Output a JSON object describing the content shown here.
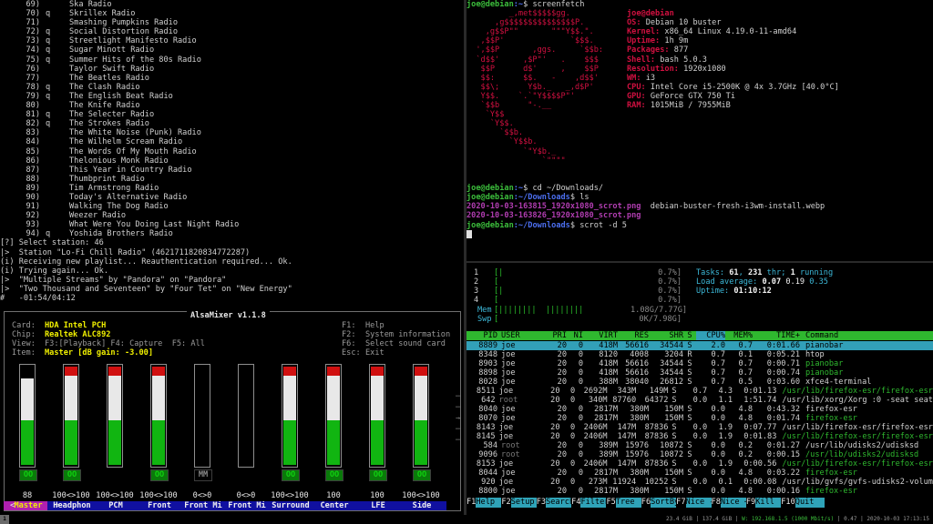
{
  "pianobar": {
    "stations": [
      {
        "num": "69)",
        "q": "",
        "name": "Ska Radio"
      },
      {
        "num": "70)",
        "q": "q",
        "name": "Skrillex Radio"
      },
      {
        "num": "71)",
        "q": "",
        "name": "Smashing Pumpkins Radio"
      },
      {
        "num": "72)",
        "q": "q",
        "name": "Social Distortion Radio"
      },
      {
        "num": "73)",
        "q": "q",
        "name": "Streetlight Manifesto Radio"
      },
      {
        "num": "74)",
        "q": "q",
        "name": "Sugar Minott Radio"
      },
      {
        "num": "75)",
        "q": "q",
        "name": "Summer Hits of the 80s Radio"
      },
      {
        "num": "76)",
        "q": "",
        "name": "Taylor Swift Radio"
      },
      {
        "num": "77)",
        "q": "",
        "name": "The Beatles Radio"
      },
      {
        "num": "78)",
        "q": "q",
        "name": "The Clash Radio"
      },
      {
        "num": "79)",
        "q": "q",
        "name": "The English Beat Radio"
      },
      {
        "num": "80)",
        "q": "",
        "name": "The Knife Radio"
      },
      {
        "num": "81)",
        "q": "q",
        "name": "The Selecter Radio"
      },
      {
        "num": "82)",
        "q": "q",
        "name": "The Strokes Radio"
      },
      {
        "num": "83)",
        "q": "",
        "name": "The White Noise (Punk) Radio"
      },
      {
        "num": "84)",
        "q": "",
        "name": "The Wilhelm Scream Radio"
      },
      {
        "num": "85)",
        "q": "",
        "name": "The Words Of My Mouth Radio"
      },
      {
        "num": "86)",
        "q": "",
        "name": "Thelonious Monk Radio"
      },
      {
        "num": "87)",
        "q": "",
        "name": "This Year in Country Radio"
      },
      {
        "num": "88)",
        "q": "",
        "name": "Thumbprint Radio"
      },
      {
        "num": "89)",
        "q": "",
        "name": "Tim Armstrong Radio"
      },
      {
        "num": "90)",
        "q": "",
        "name": "Today's Alternative Radio"
      },
      {
        "num": "91)",
        "q": "",
        "name": "Walking The Dog Radio"
      },
      {
        "num": "92)",
        "q": "",
        "name": "Weezer Radio"
      },
      {
        "num": "93)",
        "q": "",
        "name": "What Were You Doing Last Night Radio"
      },
      {
        "num": "94)",
        "q": "q",
        "name": "Yoshida Brothers Radio"
      }
    ],
    "log": [
      "[?] Select station: 46",
      "|>  Station \"Lo-Fi Chill Radio\" (4621711820834772287)",
      "(i) Receiving new playlist... Reauthentication required... Ok.",
      "(i) Trying again... Ok.",
      "|>  \"Multiple Streams\" by \"Pandora\" on \"Pandora\"",
      "|>  \"Two Thousand and Seventeen\" by \"Four Tet\" on \"New Energy\"",
      "#   -01:54/04:12"
    ]
  },
  "alsamixer": {
    "title": "AlsaMixer v1.1.8",
    "card_label": "Card:",
    "card": "HDA Intel PCH",
    "chip_label": "Chip:",
    "chip": "Realtek ALC892",
    "view_label": "View:",
    "view": "F3:[Playback] F4: Capture  F5: All",
    "item_label": "Item:",
    "item": "Master [dB gain: -3.00]",
    "help": [
      {
        "key": "F1:",
        "text": "Help"
      },
      {
        "key": "F2:",
        "text": "System information"
      },
      {
        "key": "F6:",
        "text": "Select sound card"
      },
      {
        "key": "Esc:",
        "text": "Exit"
      }
    ],
    "channels": [
      {
        "name": "Master",
        "value": "88",
        "level": 0.88,
        "mute": "OO",
        "muted": false,
        "selected": true
      },
      {
        "name": "Headphon",
        "value": "100<>100",
        "level": 1.0,
        "mute": "OO",
        "muted": false
      },
      {
        "name": "PCM",
        "value": "100<>100",
        "level": 1.0,
        "mute": "",
        "muted": false
      },
      {
        "name": "Front",
        "value": "100<>100",
        "level": 1.0,
        "mute": "OO",
        "muted": false
      },
      {
        "name": "Front Mi",
        "value": "0<>0",
        "level": 0.0,
        "mute": "MM",
        "muted": true
      },
      {
        "name": "Front Mi",
        "value": "0<>0",
        "level": 0.0,
        "mute": "",
        "muted": false
      },
      {
        "name": "Surround",
        "value": "100<>100",
        "level": 1.0,
        "mute": "OO",
        "muted": false
      },
      {
        "name": "Center",
        "value": "100",
        "level": 1.0,
        "mute": "OO",
        "muted": false
      },
      {
        "name": "LFE",
        "value": "100",
        "level": 1.0,
        "mute": "OO",
        "muted": false
      },
      {
        "name": "Side",
        "value": "100<>100",
        "level": 1.0,
        "mute": "OO",
        "muted": false
      }
    ]
  },
  "screenfetch": {
    "user": "joe@debian",
    "prompt1_cmd": "$ screenfetch",
    "logo": [
      "         _,met$$$$$gg.",
      "      ,g$$$$$$$$$$$$$$$P.",
      "    ,g$$P\"\"       \"\"\"Y$$.\".",
      "   ,$$P'              `$$$.",
      "  ',$$P       ,ggs.     `$$b:",
      "  `d$$'     ,$P\"'   .    $$$",
      "   $$P      d$'     ,    $$P",
      "   $$:      $$.   -    ,d$$'",
      "   $$\\;      Y$b._   _,d$P'",
      "   Y$$.    `.`\"Y$$$$P\"'",
      "   `$$b      \"-.__",
      "    `Y$$",
      "     `Y$$.",
      "       `$$b.",
      "         `Y$$b.",
      "            `\"Y$b._",
      "                `\"\"\"\""
    ],
    "info": [
      {
        "key": "",
        "val": "joe@debian",
        "hl": true
      },
      {
        "key": "OS:",
        "val": "Debian 10 buster"
      },
      {
        "key": "Kernel:",
        "val": "x86_64 Linux 4.19.0-11-amd64"
      },
      {
        "key": "Uptime:",
        "val": "1h 9m"
      },
      {
        "key": "Packages:",
        "val": "877"
      },
      {
        "key": "Shell:",
        "val": "bash 5.0.3"
      },
      {
        "key": "Resolution:",
        "val": "1920x1080"
      },
      {
        "key": "WM:",
        "val": "i3"
      },
      {
        "key": "CPU:",
        "val": "Intel Core i5-2500K @ 4x 3.7GHz [40.0°C]"
      },
      {
        "key": "GPU:",
        "val": "GeForce GTX 750 Ti"
      },
      {
        "key": "RAM:",
        "val": "1015MiB / 7955MiB"
      }
    ],
    "prompt2_user": "joe@debian",
    "prompt2_path": ":~",
    "prompt2_cmd": "$ cd ~/Downloads/",
    "prompt3_path": ":~/Downloads",
    "prompt3_cmd": "$ ls",
    "file1": "2020-10-03-163815_1920x1080_scrot.png",
    "file2": "debian-buster-fresh-i3wm-install.webp",
    "file3": "2020-10-03-163826_1920x1080_scrot.png",
    "prompt4_cmd": "$ scrot -d 5"
  },
  "htop": {
    "cpus": [
      {
        "n": "1",
        "bar": "[|",
        "pct": "0.7%]"
      },
      {
        "n": "2",
        "bar": "[",
        "pct": "0.7%]"
      },
      {
        "n": "3",
        "bar": "[|",
        "pct": "0.7%]"
      },
      {
        "n": "4",
        "bar": "[",
        "pct": "0.7%]"
      }
    ],
    "mem": {
      "label": "Mem",
      "bar": "[||||||||  ||||||||",
      "val": "1.08G/7.77G]"
    },
    "swp": {
      "label": "Swp",
      "bar": "[",
      "val": "0K/7.98G]"
    },
    "tasks_label": "Tasks:",
    "tasks": "61",
    "thr": "231",
    "thr_label": "thr;",
    "running": "1",
    "running_label": "running",
    "load_label": "Load average:",
    "load1": "0.07",
    "load5": "0.19",
    "load15": "0.35",
    "uptime_label": "Uptime:",
    "uptime": "01:10:12",
    "headers": [
      "PID",
      "USER",
      "PRI",
      "NI",
      "VIRT",
      "RES",
      "SHR",
      "S",
      "CPU%",
      "MEM%",
      "TIME+",
      "Command"
    ],
    "rows": [
      {
        "pid": "8889",
        "user": "joe",
        "pri": "20",
        "ni": "0",
        "virt": "418M",
        "res": "56616",
        "shr": "34544",
        "s": "S",
        "cpu": "2.0",
        "mem": "0.7",
        "time": "0:01.66",
        "cmd": "pianobar",
        "sel": true
      },
      {
        "pid": "8348",
        "user": "joe",
        "pri": "20",
        "ni": "0",
        "virt": "8120",
        "res": "4008",
        "shr": "3204",
        "s": "R",
        "cpu": "0.7",
        "mem": "0.1",
        "time": "0:05.21",
        "cmd": "htop"
      },
      {
        "pid": "8903",
        "user": "joe",
        "pri": "20",
        "ni": "0",
        "virt": "418M",
        "res": "56616",
        "shr": "34544",
        "s": "S",
        "cpu": "0.7",
        "mem": "0.7",
        "time": "0:00.71",
        "cmd": "pianobar",
        "thread": true
      },
      {
        "pid": "8898",
        "user": "joe",
        "pri": "20",
        "ni": "0",
        "virt": "418M",
        "res": "56616",
        "shr": "34544",
        "s": "S",
        "cpu": "0.7",
        "mem": "0.7",
        "time": "0:00.74",
        "cmd": "pianobar",
        "thread": true
      },
      {
        "pid": "8028",
        "user": "joe",
        "pri": "20",
        "ni": "0",
        "virt": "388M",
        "res": "38040",
        "shr": "26812",
        "s": "S",
        "cpu": "0.7",
        "mem": "0.5",
        "time": "0:03.60",
        "cmd": "xfce4-terminal"
      },
      {
        "pid": "8511",
        "user": "joe",
        "pri": "20",
        "ni": "0",
        "virt": "2692M",
        "res": "343M",
        "shr": "149M",
        "s": "S",
        "cpu": "0.7",
        "mem": "4.3",
        "time": "0:01.13",
        "cmd": "/usr/lib/firefox-esr/firefox-esr",
        "thread": true
      },
      {
        "pid": "642",
        "user": "root",
        "pri": "20",
        "ni": "0",
        "virt": "340M",
        "res": "87760",
        "shr": "64372",
        "s": "S",
        "cpu": "0.0",
        "mem": "1.1",
        "time": "1:51.74",
        "cmd": "/usr/lib/xorg/Xorg :0 -seat seat"
      },
      {
        "pid": "8040",
        "user": "joe",
        "pri": "20",
        "ni": "0",
        "virt": "2817M",
        "res": "380M",
        "shr": "150M",
        "s": "S",
        "cpu": "0.0",
        "mem": "4.8",
        "time": "0:43.32",
        "cmd": "firefox-esr"
      },
      {
        "pid": "8070",
        "user": "joe",
        "pri": "20",
        "ni": "0",
        "virt": "2817M",
        "res": "380M",
        "shr": "150M",
        "s": "S",
        "cpu": "0.0",
        "mem": "4.8",
        "time": "0:01.74",
        "cmd": "firefox-esr",
        "thread": true
      },
      {
        "pid": "8143",
        "user": "joe",
        "pri": "20",
        "ni": "0",
        "virt": "2406M",
        "res": "147M",
        "shr": "87836",
        "s": "S",
        "cpu": "0.0",
        "mem": "1.9",
        "time": "0:07.77",
        "cmd": "/usr/lib/firefox-esr/firefox-esr"
      },
      {
        "pid": "8145",
        "user": "joe",
        "pri": "20",
        "ni": "0",
        "virt": "2406M",
        "res": "147M",
        "shr": "87836",
        "s": "S",
        "cpu": "0.0",
        "mem": "1.9",
        "time": "0:01.83",
        "cmd": "/usr/lib/firefox-esr/firefox-esr",
        "thread": true
      },
      {
        "pid": "584",
        "user": "root",
        "pri": "20",
        "ni": "0",
        "virt": "389M",
        "res": "15976",
        "shr": "10872",
        "s": "S",
        "cpu": "0.0",
        "mem": "0.2",
        "time": "0:01.27",
        "cmd": "/usr/lib/udisks2/udisksd"
      },
      {
        "pid": "9096",
        "user": "root",
        "pri": "20",
        "ni": "0",
        "virt": "389M",
        "res": "15976",
        "shr": "10872",
        "s": "S",
        "cpu": "0.0",
        "mem": "0.2",
        "time": "0:00.15",
        "cmd": "/usr/lib/udisks2/udisksd",
        "thread": true
      },
      {
        "pid": "8153",
        "user": "joe",
        "pri": "20",
        "ni": "0",
        "virt": "2406M",
        "res": "147M",
        "shr": "87836",
        "s": "S",
        "cpu": "0.0",
        "mem": "1.9",
        "time": "0:00.56",
        "cmd": "/usr/lib/firefox-esr/firefox-esr",
        "thread": true
      },
      {
        "pid": "8044",
        "user": "joe",
        "pri": "20",
        "ni": "0",
        "virt": "2817M",
        "res": "380M",
        "shr": "150M",
        "s": "S",
        "cpu": "0.0",
        "mem": "4.8",
        "time": "0:03.22",
        "cmd": "firefox-esr",
        "thread": true
      },
      {
        "pid": "920",
        "user": "joe",
        "pri": "20",
        "ni": "0",
        "virt": "273M",
        "res": "11924",
        "shr": "10252",
        "s": "S",
        "cpu": "0.0",
        "mem": "0.1",
        "time": "0:00.08",
        "cmd": "/usr/lib/gvfs/gvfs-udisks2-volum"
      },
      {
        "pid": "8800",
        "user": "joe",
        "pri": "20",
        "ni": "0",
        "virt": "2817M",
        "res": "380M",
        "shr": "150M",
        "s": "S",
        "cpu": "0.0",
        "mem": "4.8",
        "time": "0:00.16",
        "cmd": "firefox-esr",
        "thread": true
      }
    ],
    "fkeys": [
      {
        "k": "F1",
        "l": "Help"
      },
      {
        "k": "F2",
        "l": "Setup"
      },
      {
        "k": "F3",
        "l": "Search"
      },
      {
        "k": "F4",
        "l": "Filter"
      },
      {
        "k": "F5",
        "l": "Tree"
      },
      {
        "k": "F6",
        "l": "SortBy"
      },
      {
        "k": "F7",
        "l": "Nice -"
      },
      {
        "k": "F8",
        "l": "Nice +"
      },
      {
        "k": "F9",
        "l": "Kill"
      },
      {
        "k": "F10",
        "l": "Quit"
      }
    ]
  },
  "statusbar": {
    "workspace": "1",
    "text_a": "23.4 GiB | 137.4 GiB | ",
    "text_b": "W: 192.168.1.5 (1000 Mbit/s)",
    "text_c": " | 0.47 | 2020-10-03 17:13:15"
  }
}
